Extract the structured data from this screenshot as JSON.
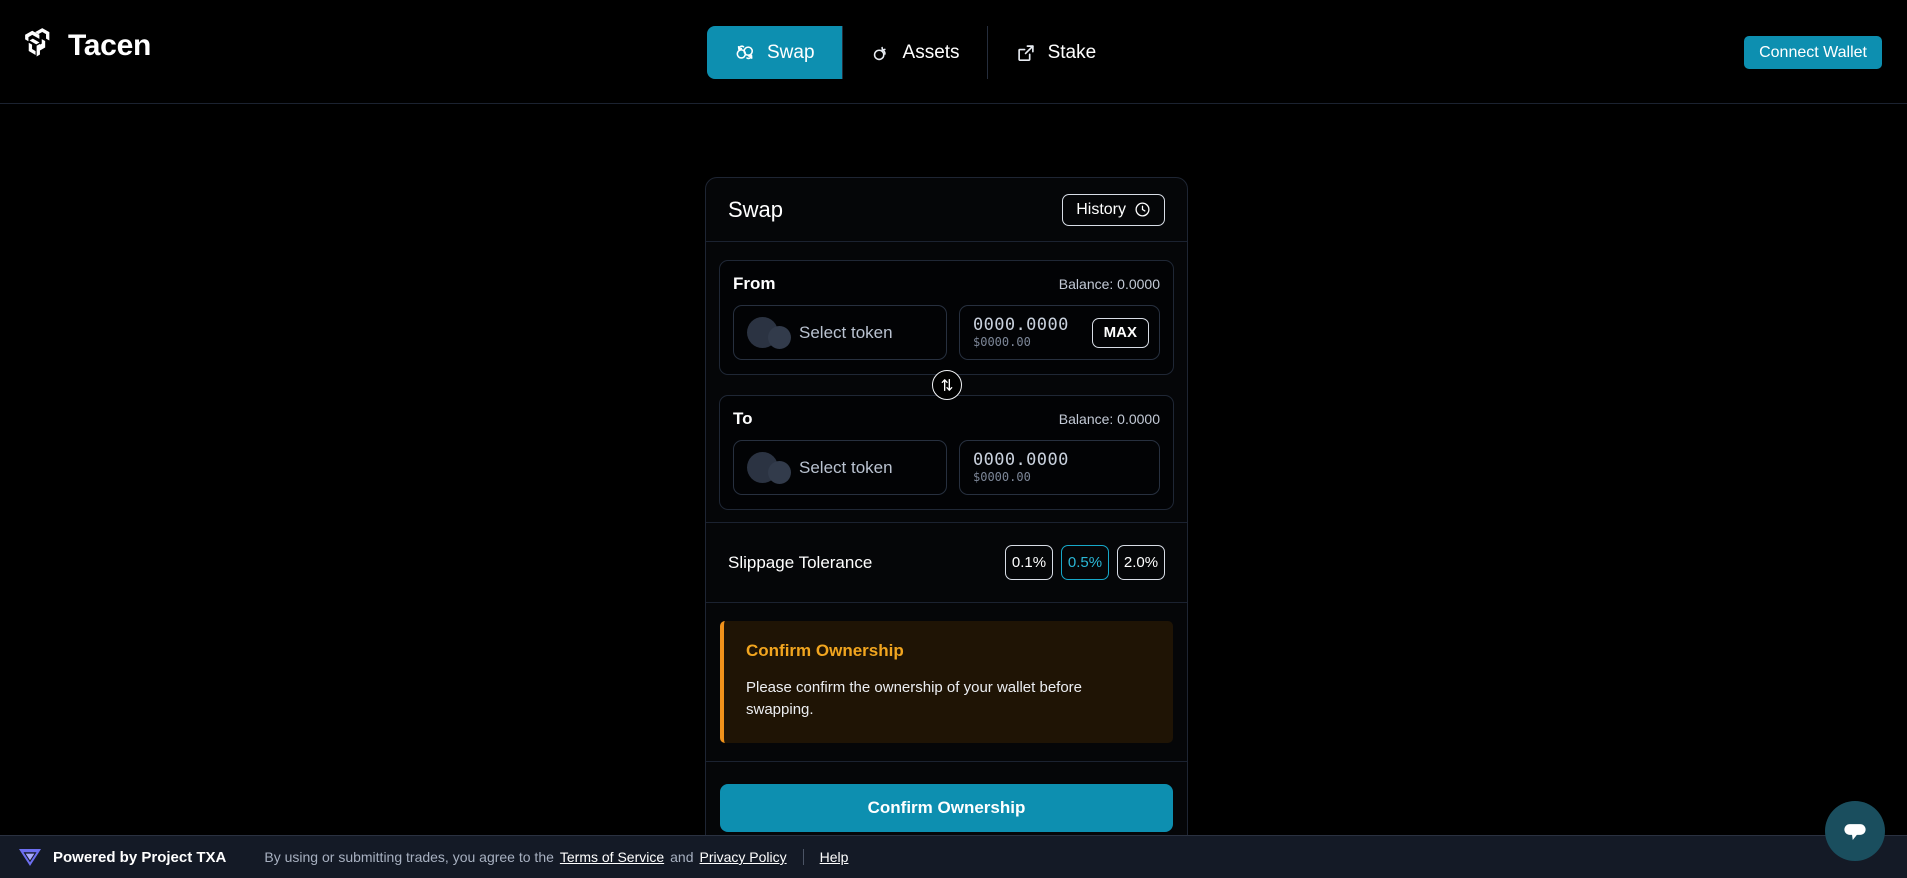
{
  "brand": {
    "name": "Tacen",
    "logo_icon": "tacen-logo-icon"
  },
  "nav": {
    "tabs": [
      {
        "label": "Swap",
        "icon": "swap-circles-icon",
        "active": true
      },
      {
        "label": "Assets",
        "icon": "assets-circles-icon",
        "active": false
      },
      {
        "label": "Stake",
        "icon": "external-link-icon",
        "active": false
      }
    ],
    "connect_wallet_label": "Connect Wallet"
  },
  "swap_card": {
    "title": "Swap",
    "history_label": "History",
    "history_icon": "clock-icon",
    "from": {
      "label": "From",
      "balance": "Balance: 0.0000",
      "token_placeholder": "Select token",
      "amount": "0000.0000",
      "amount_usd": "$0000.00",
      "max_label": "MAX"
    },
    "to": {
      "label": "To",
      "balance": "Balance: 0.0000",
      "token_placeholder": "Select token",
      "amount": "0000.0000",
      "amount_usd": "$0000.00"
    },
    "swap_toggle_icon": "arrows-up-down-icon",
    "slippage": {
      "label": "Slippage Tolerance",
      "options": [
        "0.1%",
        "0.5%",
        "2.0%"
      ],
      "selected": "0.5%"
    },
    "notice": {
      "title": "Confirm Ownership",
      "text": "Please confirm the ownership of your wallet before swapping."
    },
    "action_label": "Confirm Ownership"
  },
  "footer": {
    "powered_by": "Powered by Project TXA",
    "logo_icon": "project-txa-logo-icon",
    "legal_prefix": "By using or submitting trades, you agree to the",
    "terms_label": "Terms of Service",
    "legal_conjunction": "and",
    "privacy_label": "Privacy Policy",
    "help_label": "Help"
  },
  "chat": {
    "icon": "chat-bubble-icon"
  },
  "colors": {
    "accent_teal": "#0d8fb0",
    "accent_teal_bright": "#2ab7d6",
    "warning_orange": "#f0921b",
    "warning_bg": "#1f1405",
    "footer_bg": "#141a26",
    "page_bg": "#000000",
    "card_border": "#1e2533",
    "token_circle": "#2b3342",
    "chat_bg": "#1a4e5e"
  }
}
